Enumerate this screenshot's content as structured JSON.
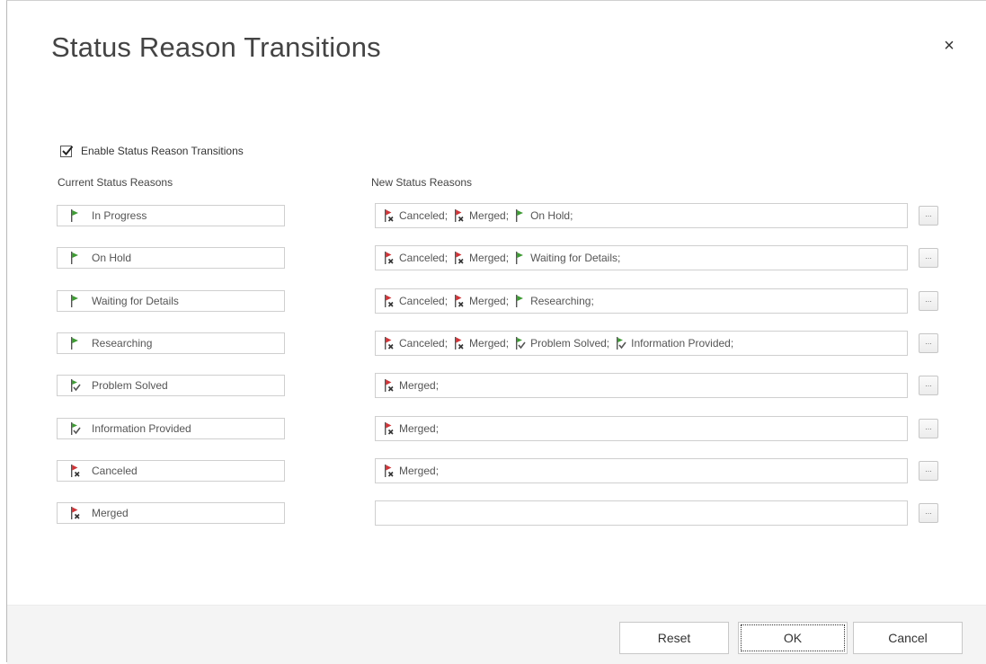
{
  "dialog": {
    "title": "Status Reason Transitions",
    "close_glyph": "×"
  },
  "enable": {
    "label": "Enable Status Reason Transitions",
    "checked": true
  },
  "columns": {
    "current_header": "Current Status Reasons",
    "new_header": "New Status Reasons"
  },
  "icons": {
    "active": "green-flag-icon",
    "resolved": "green-flag-check-icon",
    "canceled": "red-flag-x-icon"
  },
  "colors": {
    "green_flag": "#3f9c35",
    "red_flag": "#d13438"
  },
  "rows": [
    {
      "current": {
        "icon": "active",
        "label": "In Progress"
      },
      "new": [
        {
          "icon": "canceled",
          "label": "Canceled;"
        },
        {
          "icon": "canceled",
          "label": "Merged;"
        },
        {
          "icon": "active",
          "label": "On Hold;"
        }
      ]
    },
    {
      "current": {
        "icon": "active",
        "label": "On Hold"
      },
      "new": [
        {
          "icon": "canceled",
          "label": "Canceled;"
        },
        {
          "icon": "canceled",
          "label": "Merged;"
        },
        {
          "icon": "active",
          "label": "Waiting for Details;"
        }
      ]
    },
    {
      "current": {
        "icon": "active",
        "label": "Waiting for Details"
      },
      "new": [
        {
          "icon": "canceled",
          "label": "Canceled;"
        },
        {
          "icon": "canceled",
          "label": "Merged;"
        },
        {
          "icon": "active",
          "label": "Researching;"
        }
      ]
    },
    {
      "current": {
        "icon": "active",
        "label": "Researching"
      },
      "new": [
        {
          "icon": "canceled",
          "label": "Canceled;"
        },
        {
          "icon": "canceled",
          "label": "Merged;"
        },
        {
          "icon": "resolved",
          "label": "Problem Solved;"
        },
        {
          "icon": "resolved",
          "label": "Information Provided;"
        }
      ]
    },
    {
      "current": {
        "icon": "resolved",
        "label": "Problem Solved"
      },
      "new": [
        {
          "icon": "canceled",
          "label": "Merged;"
        }
      ]
    },
    {
      "current": {
        "icon": "resolved",
        "label": "Information Provided"
      },
      "new": [
        {
          "icon": "canceled",
          "label": "Merged;"
        }
      ]
    },
    {
      "current": {
        "icon": "canceled",
        "label": "Canceled"
      },
      "new": [
        {
          "icon": "canceled",
          "label": "Merged;"
        }
      ]
    },
    {
      "current": {
        "icon": "canceled",
        "label": "Merged"
      },
      "new": []
    }
  ],
  "lookup_button_label": "...",
  "buttons": {
    "reset": "Reset",
    "ok": "OK",
    "cancel": "Cancel"
  }
}
